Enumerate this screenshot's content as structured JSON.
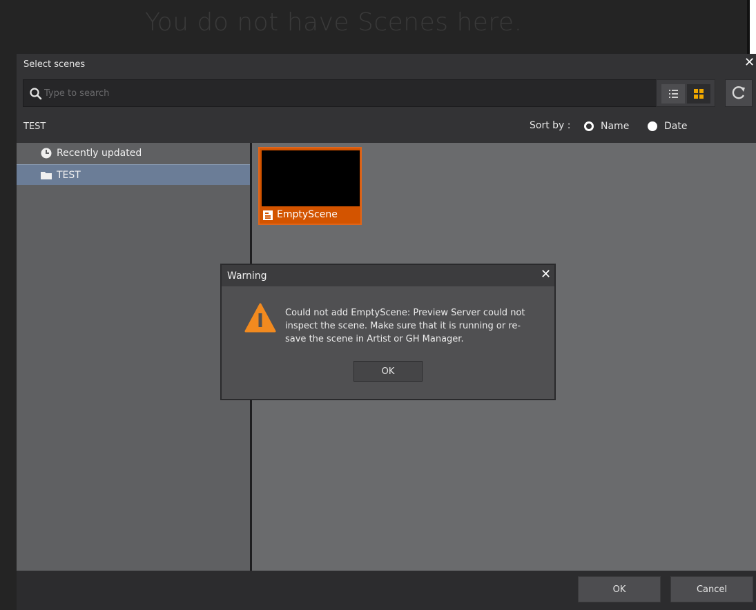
{
  "background": {
    "headline": "You do not have Scenes here."
  },
  "dialog": {
    "title": "Select scenes",
    "search": {
      "placeholder": "Type to search",
      "value": ""
    },
    "path_label": "TEST",
    "sort": {
      "label": "Sort by :",
      "options": [
        {
          "label": "Name",
          "selected": true
        },
        {
          "label": "Date",
          "selected": false
        }
      ]
    },
    "tree": [
      {
        "label": "Recently updated",
        "icon": "clock-icon",
        "selected": false
      },
      {
        "label": "TEST",
        "icon": "folder-icon",
        "selected": true
      }
    ],
    "scenes": [
      {
        "name": "EmptyScene",
        "icon": "scene-file-icon",
        "selected": true
      }
    ],
    "footer": {
      "ok_label": "OK",
      "cancel_label": "Cancel"
    }
  },
  "warning": {
    "title": "Warning",
    "message": "Could not add EmptyScene: Preview Server could not inspect the scene. Make sure that it is running or re-save the scene in Artist or GH Manager.",
    "ok_label": "OK"
  },
  "colors": {
    "accent_orange": "#d35400",
    "selected_tree": "#6b7d97",
    "grid_icon": "#f0a800"
  }
}
